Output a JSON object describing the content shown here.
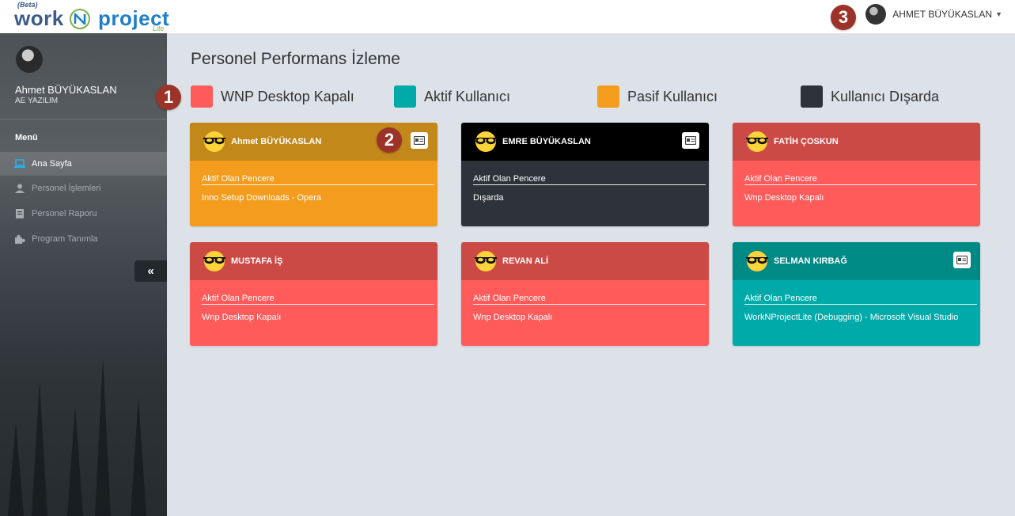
{
  "app": {
    "logo_beta": "(Beta)",
    "logo_word1": "work",
    "logo_word2": "project",
    "logo_lite": "Lite",
    "user_menu_name": "AHMET BÜYÜKASLAN"
  },
  "sidebar": {
    "user_name": "Ahmet BÜYÜKASLAN",
    "company": "AE YAZILIM",
    "menu_title": "Menü",
    "items": [
      {
        "label": "Ana Sayfa",
        "icon": "laptop-icon"
      },
      {
        "label": "Personel İşlemleri",
        "icon": "user-icon"
      },
      {
        "label": "Personel Raporu",
        "icon": "report-icon"
      },
      {
        "label": "Program Tanımla",
        "icon": "puzzle-icon"
      }
    ],
    "collapse_glyph": "«"
  },
  "annotations": {
    "b1": "1",
    "b2": "2",
    "b3": "3"
  },
  "page": {
    "title": "Personel Performans İzleme"
  },
  "legend": [
    {
      "label": "WNP Desktop Kapalı",
      "color": "#ff5b5b"
    },
    {
      "label": "Aktif Kullanıcı",
      "color": "#00aaa9"
    },
    {
      "label": "Pasif Kullanıcı",
      "color": "#f39c1d"
    },
    {
      "label": "Kullanıcı Dışarda",
      "color": "#2d3339"
    }
  ],
  "cards": [
    {
      "name": "Ahmet BÜYÜKASLAN",
      "section": "Aktif Olan Pencere",
      "value": "Inno Setup Downloads - Opera",
      "head_color": "#c2881a",
      "body_color": "#f39c1d",
      "has_id_button": true
    },
    {
      "name": "EMRE BÜYÜKASLAN",
      "section": "Aktif Olan Pencere",
      "value": "Dışarda",
      "head_color": "#000000",
      "body_color": "#2d3339",
      "has_id_button": true
    },
    {
      "name": "FATİH ÇOSKUN",
      "section": "Aktif Olan Pencere",
      "value": "Wnp Desktop Kapalı",
      "head_color": "#cc4a46",
      "body_color": "#ff5b5b",
      "has_id_button": false
    },
    {
      "name": "MUSTAFA İŞ",
      "section": "Aktif Olan Pencere",
      "value": "Wnp Desktop Kapalı",
      "head_color": "#cc4a46",
      "body_color": "#ff5b5b",
      "has_id_button": false
    },
    {
      "name": "REVAN ALİ",
      "section": "Aktif Olan Pencere",
      "value": "Wnp Desktop Kapalı",
      "head_color": "#cc4a46",
      "body_color": "#ff5b5b",
      "has_id_button": false
    },
    {
      "name": "SELMAN KIRBAĞ",
      "section": "Aktif Olan Pencere",
      "value": "WorkNProjectLite (Debugging) - Microsoft Visual Studio",
      "head_color": "#008a85",
      "body_color": "#00aaa9",
      "has_id_button": true
    }
  ]
}
